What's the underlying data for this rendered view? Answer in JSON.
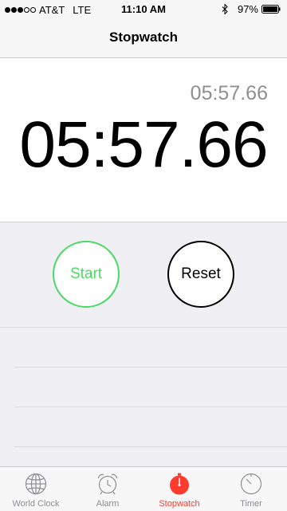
{
  "status_bar": {
    "carrier": "AT&T",
    "network": "LTE",
    "time": "11:10 AM",
    "battery": "97%",
    "signal_bars_filled": 3,
    "signal_bars_total": 5
  },
  "nav": {
    "title": "Stopwatch"
  },
  "stopwatch": {
    "lap_time": "05:57.66",
    "main_minutes": "05",
    "main_sep1": ":",
    "main_seconds": "57",
    "main_sep2": ".",
    "main_hundredths": "66"
  },
  "controls": {
    "start_label": "Start",
    "reset_label": "Reset"
  },
  "tab_bar": {
    "items": [
      {
        "label": "World Clock",
        "icon": "globe-icon"
      },
      {
        "label": "Alarm",
        "icon": "alarm-clock-icon"
      },
      {
        "label": "Stopwatch",
        "icon": "stopwatch-icon",
        "active": true
      },
      {
        "label": "Timer",
        "icon": "timer-icon"
      }
    ]
  },
  "colors": {
    "accent": "#ff3b30",
    "start_green": "#4cd964",
    "inactive_gray": "#8e8e93"
  }
}
